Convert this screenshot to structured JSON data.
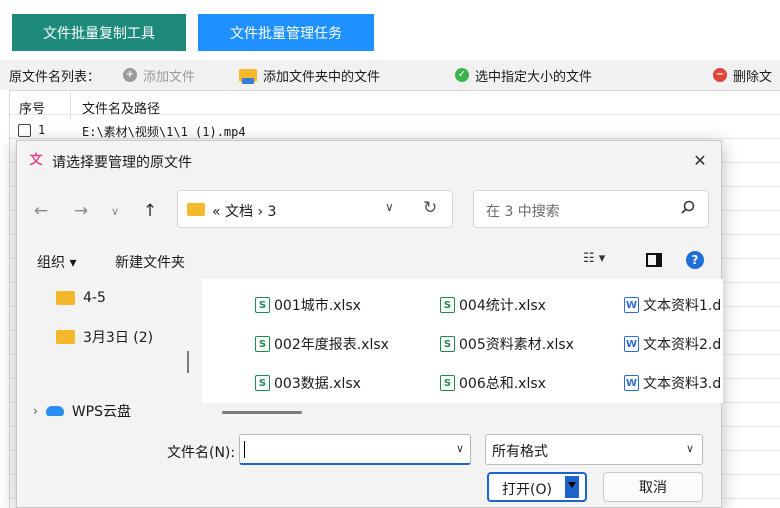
{
  "app": {
    "tabs": [
      {
        "label": "文件批量复制工具"
      },
      {
        "label": "文件批量管理任务"
      }
    ],
    "toolbar": {
      "list_label": "原文件名列表：",
      "add_file": "添加文件",
      "add_folder_files": "添加文件夹中的文件",
      "select_size": "选中指定大小的文件",
      "delete": "删除文"
    },
    "table": {
      "headers": {
        "no": "序号",
        "path": "文件名及路径"
      },
      "rows": [
        {
          "no": "1",
          "path": "E:\\素材\\视频\\1\\1 (1).mp4"
        }
      ]
    }
  },
  "dialog": {
    "title": "请选择要管理的原文件",
    "close_glyph": "✕",
    "nav": {
      "back": "←",
      "forward": "→",
      "recent": "∨",
      "up": "↑"
    },
    "address": {
      "breadcrumb": "« 文档 › 3",
      "dropdown": "∨",
      "refresh": "↻"
    },
    "search": {
      "placeholder": "在 3 中搜索"
    },
    "commands": {
      "organize": "组织 ▾",
      "new_folder": "新建文件夹",
      "view": "☷ ▾",
      "help": "?"
    },
    "nav_pane": [
      {
        "label": "4-5",
        "icon": "folder-icon"
      },
      {
        "label": "3月3日 (2)",
        "icon": "folder-icon"
      },
      {
        "label": "WPS云盘",
        "icon": "cloud-icon",
        "arrow": "›"
      }
    ],
    "files": [
      {
        "name": "001城市.xlsx",
        "type": "xlsx"
      },
      {
        "name": "002年度报表.xlsx",
        "type": "xlsx"
      },
      {
        "name": "003数据.xlsx",
        "type": "xlsx"
      },
      {
        "name": "004统计.xlsx",
        "type": "xlsx"
      },
      {
        "name": "005资料素材.xlsx",
        "type": "xlsx"
      },
      {
        "name": "006总和.xlsx",
        "type": "xlsx"
      },
      {
        "name": "文本资料1.d",
        "type": "docx"
      },
      {
        "name": "文本资料2.d",
        "type": "docx"
      },
      {
        "name": "文本资料3.d",
        "type": "docx"
      }
    ],
    "file_icons": {
      "xlsx": "S",
      "docx": "W"
    },
    "filename_label": "文件名(N):",
    "filename_value": "",
    "format_value": "所有格式",
    "dropdown_glyph": "∨",
    "open_label": "打开(O)",
    "cancel_label": "取消"
  },
  "colors": {
    "tab1": "#1d8a7c",
    "tab2": "#1e90ff",
    "accent": "#1e63c9"
  }
}
